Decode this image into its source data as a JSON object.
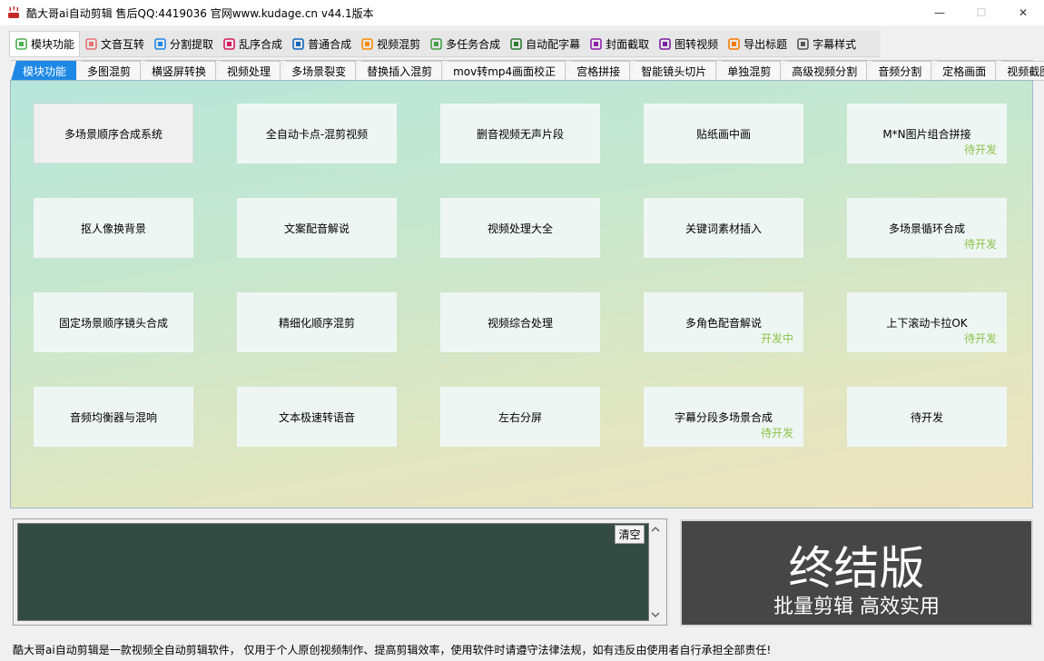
{
  "window": {
    "title": "酷大哥ai自动剪辑 售后QQ:4419036 官网www.kudage.cn   v44.1版本",
    "minimize": "—",
    "maximize": "☐",
    "close": "✕"
  },
  "toolbar": {
    "items": [
      {
        "label": "模块功能",
        "icon": "grid-icon",
        "color": "#4caf50"
      },
      {
        "label": "文音互转",
        "icon": "text-audio-icon",
        "color": "#e57373"
      },
      {
        "label": "分割提取",
        "icon": "split-icon",
        "color": "#1e88e5"
      },
      {
        "label": "乱序合成",
        "icon": "shuffle-icon",
        "color": "#d81b60"
      },
      {
        "label": "普通合成",
        "icon": "layers-icon",
        "color": "#1565c0"
      },
      {
        "label": "视频混剪",
        "icon": "video-mix-icon",
        "color": "#fb8c00"
      },
      {
        "label": "多任务合成",
        "icon": "task-icon",
        "color": "#43a047"
      },
      {
        "label": "自动配字幕",
        "icon": "bar-chart-icon",
        "color": "#2e7d32"
      },
      {
        "label": "封面截取",
        "icon": "cover-icon",
        "color": "#8e24aa"
      },
      {
        "label": "图转视频",
        "icon": "image-video-icon",
        "color": "#7b1fa2"
      },
      {
        "label": "导出标题",
        "icon": "export-icon",
        "color": "#f57c00"
      },
      {
        "label": "字幕样式",
        "icon": "caption-icon",
        "color": "#555555"
      }
    ]
  },
  "subtabs": [
    "模块功能",
    "多图混剪",
    "横竖屏转换",
    "视频处理",
    "多场景裂变",
    "替换插入混剪",
    "mov转mp4画面校正",
    "宫格拼接",
    "智能镜头切片",
    "单独混剪",
    "高级视频分割",
    "音频分割",
    "定格画面",
    "视频截图"
  ],
  "functions": [
    {
      "label": "多场景顺序合成系统",
      "badge": ""
    },
    {
      "label": "全自动卡点-混剪视频",
      "badge": ""
    },
    {
      "label": "删音视频无声片段",
      "badge": ""
    },
    {
      "label": "贴纸画中画",
      "badge": ""
    },
    {
      "label": "M*N图片组合拼接",
      "badge": "待开发"
    },
    {
      "label": "抠人像换背景",
      "badge": ""
    },
    {
      "label": "文案配音解说",
      "badge": ""
    },
    {
      "label": "视频处理大全",
      "badge": ""
    },
    {
      "label": "关键词素材插入",
      "badge": ""
    },
    {
      "label": "多场景循环合成",
      "badge": "待开发"
    },
    {
      "label": "固定场景顺序镜头合成",
      "badge": ""
    },
    {
      "label": "精细化顺序混剪",
      "badge": ""
    },
    {
      "label": "视频综合处理",
      "badge": ""
    },
    {
      "label": "多角色配音解说",
      "badge": "开发中"
    },
    {
      "label": "上下滚动卡拉OK",
      "badge": "待开发"
    },
    {
      "label": "音频均衡器与混响",
      "badge": ""
    },
    {
      "label": "文本极速转语音",
      "badge": ""
    },
    {
      "label": "左右分屏",
      "badge": ""
    },
    {
      "label": "字幕分段多场景合成",
      "badge": "待开发"
    },
    {
      "label": "待开发",
      "badge": ""
    }
  ],
  "log": {
    "clear_label": "清空"
  },
  "promo": {
    "title": "终结版",
    "subtitle": "批量剪辑 高效实用"
  },
  "status": "酷大哥ai自动剪辑是一款视频全自动剪辑软件， 仅用于个人原创视频制作、提高剪辑效率，使用软件时请遵守法律法规，如有违反由使用者自行承担全部责任!"
}
